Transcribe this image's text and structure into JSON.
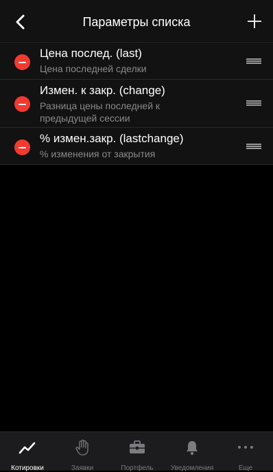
{
  "header": {
    "title": "Параметры списка",
    "back_icon": "chevron-left-icon",
    "add_icon": "plus-icon"
  },
  "list": {
    "items": [
      {
        "title": "Цена послед. (last)",
        "subtitle": "Цена последней сделки"
      },
      {
        "title": "Измен. к закр. (change)",
        "subtitle": "Разница цены последней к предыдущей сессии"
      },
      {
        "title": "% измен.закр. (lastchange)",
        "subtitle": "% изменения от закрытия"
      }
    ]
  },
  "tabbar": {
    "tabs": [
      {
        "label": "Котировки",
        "icon": "chart-line-icon",
        "active": true
      },
      {
        "label": "Заявки",
        "icon": "hand-icon",
        "active": false
      },
      {
        "label": "Портфель",
        "icon": "briefcase-icon",
        "active": false
      },
      {
        "label": "Уведомления",
        "icon": "bell-icon",
        "active": false
      },
      {
        "label": "Еще",
        "icon": "more-dots-icon",
        "active": false
      }
    ]
  },
  "colors": {
    "delete_red": "#f23a30",
    "background": "#000000",
    "list_background": "#121212",
    "tabbar_background": "#1c1c1e",
    "inactive_tab": "#7b7b80",
    "active_tab": "#ffffff"
  }
}
